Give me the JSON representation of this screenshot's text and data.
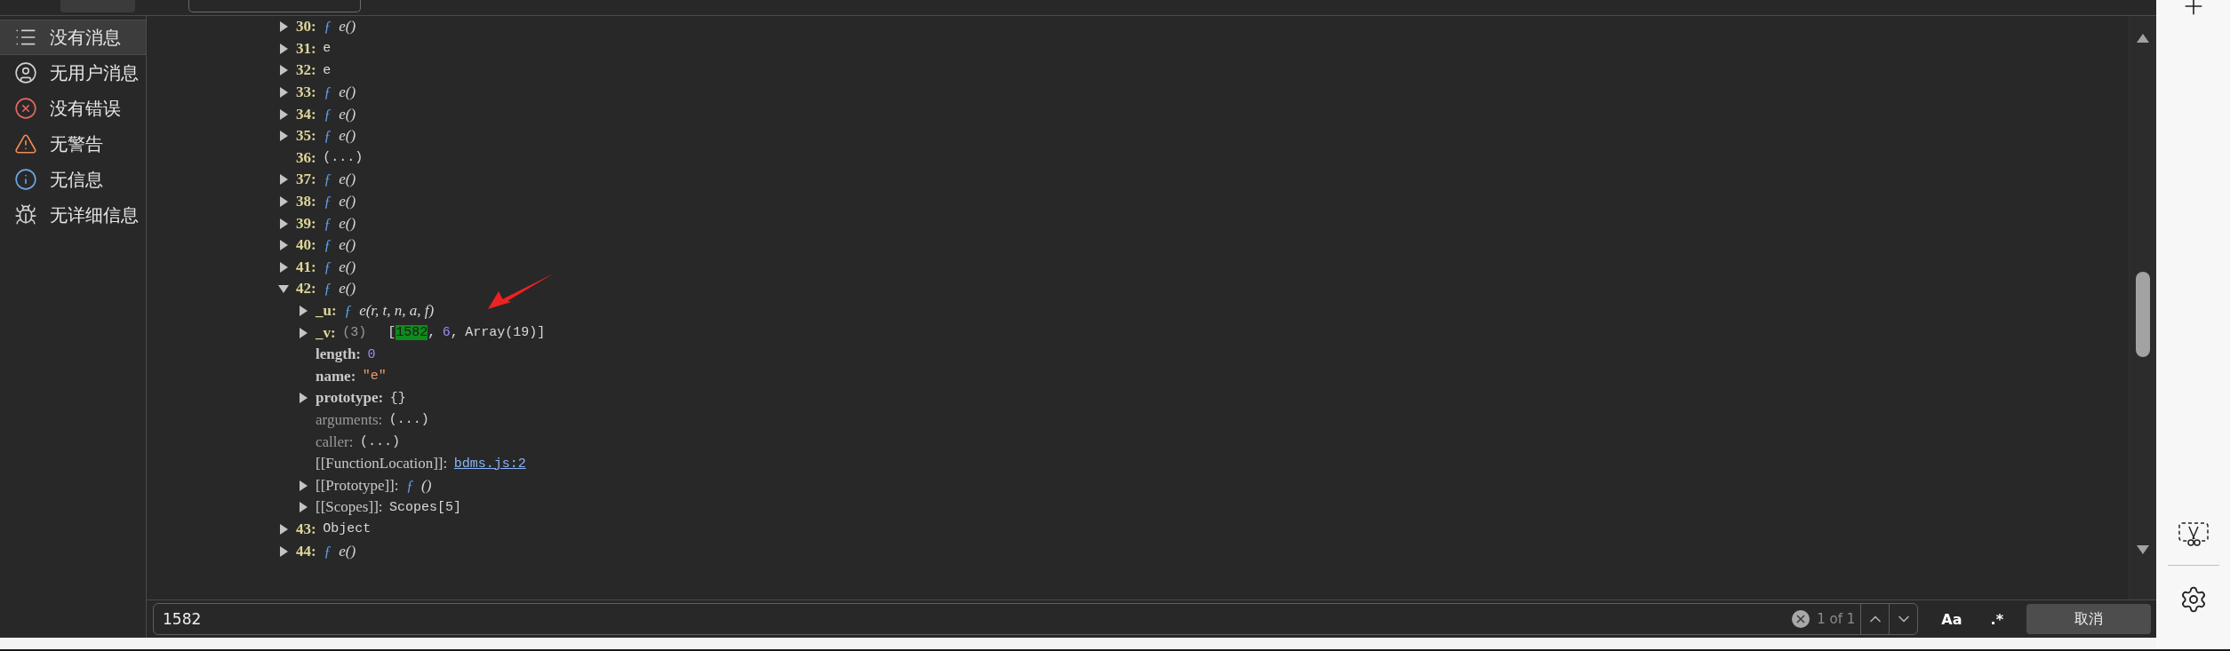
{
  "sidebar": {
    "items": [
      {
        "kind": "messages",
        "label": "没有消息",
        "selected": true
      },
      {
        "kind": "user",
        "label": "无用户消息",
        "selected": false
      },
      {
        "kind": "errors",
        "label": "没有错误",
        "selected": false
      },
      {
        "kind": "warnings",
        "label": "无警告",
        "selected": false
      },
      {
        "kind": "info",
        "label": "无信息",
        "selected": false
      },
      {
        "kind": "verbose",
        "label": "无详细信息",
        "selected": false
      }
    ]
  },
  "tree": [
    {
      "key": "30:",
      "kind": "index",
      "expanded": false,
      "value": [
        {
          "kind": "f",
          "text": "ƒ"
        },
        {
          "kind": "sig",
          "text": "e()"
        }
      ]
    },
    {
      "key": "31:",
      "kind": "index",
      "expanded": false,
      "value": [
        {
          "kind": "plain",
          "text": "e"
        }
      ]
    },
    {
      "key": "32:",
      "kind": "index",
      "expanded": false,
      "value": [
        {
          "kind": "plain",
          "text": "e"
        }
      ]
    },
    {
      "key": "33:",
      "kind": "index",
      "expanded": false,
      "value": [
        {
          "kind": "f",
          "text": "ƒ"
        },
        {
          "kind": "sig",
          "text": "e()"
        }
      ]
    },
    {
      "key": "34:",
      "kind": "index",
      "expanded": false,
      "value": [
        {
          "kind": "f",
          "text": "ƒ"
        },
        {
          "kind": "sig",
          "text": "e()"
        }
      ]
    },
    {
      "key": "35:",
      "kind": "index",
      "expanded": false,
      "value": [
        {
          "kind": "f",
          "text": "ƒ"
        },
        {
          "kind": "sig",
          "text": "e()"
        }
      ]
    },
    {
      "key": "36:",
      "kind": "index",
      "value": [
        {
          "kind": "plain",
          "text": "(...)"
        }
      ]
    },
    {
      "key": "37:",
      "kind": "index",
      "expanded": false,
      "value": [
        {
          "kind": "f",
          "text": "ƒ"
        },
        {
          "kind": "sig",
          "text": "e()"
        }
      ]
    },
    {
      "key": "38:",
      "kind": "index",
      "expanded": false,
      "value": [
        {
          "kind": "f",
          "text": "ƒ"
        },
        {
          "kind": "sig",
          "text": "e()"
        }
      ]
    },
    {
      "key": "39:",
      "kind": "index",
      "expanded": false,
      "value": [
        {
          "kind": "f",
          "text": "ƒ"
        },
        {
          "kind": "sig",
          "text": "e()"
        }
      ]
    },
    {
      "key": "40:",
      "kind": "index",
      "expanded": false,
      "value": [
        {
          "kind": "f",
          "text": "ƒ"
        },
        {
          "kind": "sig",
          "text": "e()"
        }
      ]
    },
    {
      "key": "41:",
      "kind": "index",
      "expanded": false,
      "value": [
        {
          "kind": "f",
          "text": "ƒ"
        },
        {
          "kind": "sig",
          "text": "e()"
        }
      ]
    },
    {
      "key": "42:",
      "kind": "index",
      "expanded": true,
      "value": [
        {
          "kind": "f",
          "text": "ƒ"
        },
        {
          "kind": "sig",
          "text": "e()"
        }
      ],
      "children": [
        {
          "key": "_u:",
          "kind": "own",
          "expanded": false,
          "value": [
            {
              "kind": "f",
              "text": "ƒ"
            },
            {
              "kind": "sig",
              "text": "e(r, t, n, a, f)"
            }
          ]
        },
        {
          "key": "_v:",
          "kind": "own",
          "expanded": false,
          "value": [
            {
              "kind": "dim",
              "text": "(3)"
            },
            {
              "kind": "open",
              "text": "["
            },
            {
              "kind": "match",
              "text": "1582"
            },
            {
              "kind": "punct",
              "text": ","
            },
            {
              "kind": "number",
              "text": "6"
            },
            {
              "kind": "punct",
              "text": ","
            },
            {
              "kind": "plain",
              "text": "Array(19)]"
            }
          ]
        },
        {
          "key": "length:",
          "kind": "prop",
          "value": [
            {
              "kind": "number",
              "text": "0"
            }
          ]
        },
        {
          "key": "name:",
          "kind": "prop",
          "value": [
            {
              "kind": "string",
              "text": "\"e\""
            }
          ]
        },
        {
          "key": "prototype:",
          "kind": "prop",
          "expanded": false,
          "value": [
            {
              "kind": "plain",
              "text": "{}"
            }
          ]
        },
        {
          "key": "arguments:",
          "kind": "dim",
          "value": [
            {
              "kind": "plain",
              "text": "(...)"
            }
          ]
        },
        {
          "key": "caller:",
          "kind": "dim",
          "value": [
            {
              "kind": "plain",
              "text": "(...)"
            }
          ]
        },
        {
          "key": "[[FunctionLocation]]:",
          "kind": "internal",
          "value": [
            {
              "kind": "link",
              "text": "bdms.js:2"
            }
          ]
        },
        {
          "key": "[[Prototype]]:",
          "kind": "internal",
          "expanded": false,
          "value": [
            {
              "kind": "f",
              "text": "ƒ"
            },
            {
              "kind": "sig",
              "text": "()"
            }
          ]
        },
        {
          "key": "[[Scopes]]:",
          "kind": "internal",
          "expanded": false,
          "value": [
            {
              "kind": "plain",
              "text": "Scopes[5]"
            }
          ]
        }
      ]
    },
    {
      "key": "43:",
      "kind": "index",
      "expanded": false,
      "value": [
        {
          "kind": "plain",
          "text": "Object"
        }
      ]
    },
    {
      "key": "44:",
      "kind": "index",
      "expanded": false,
      "value": [
        {
          "kind": "f",
          "text": "ƒ"
        },
        {
          "kind": "sig",
          "text": "e()"
        }
      ]
    }
  ],
  "find_bar": {
    "query": "1582",
    "match_count": "1 of 1",
    "case_label": "Aa",
    "regex_label": ".*",
    "cancel_label": "取消"
  }
}
